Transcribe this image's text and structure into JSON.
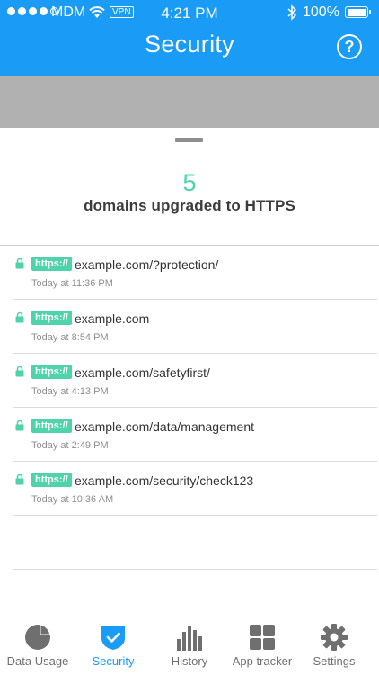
{
  "status_bar": {
    "carrier": "MDM",
    "vpn": "VPN",
    "time": "4:21 PM",
    "battery": "100%"
  },
  "header": {
    "title": "Security",
    "help": "?"
  },
  "summary": {
    "count": "5",
    "label": "domains upgraded to HTTPS"
  },
  "badge_text": "https://",
  "domains": [
    {
      "url": "example.com/?protection/",
      "time": "Today at 11:36 PM"
    },
    {
      "url": "example.com",
      "time": "Today at 8:54 PM"
    },
    {
      "url": "example.com/safetyfirst/",
      "time": "Today at 4:13 PM"
    },
    {
      "url": "example.com/data/management",
      "time": "Today at 2:49 PM"
    },
    {
      "url": "example.com/security/check123",
      "time": "Today at 10:36 AM"
    }
  ],
  "tabs": [
    {
      "label": "Data Usage",
      "icon": "pie-chart-icon",
      "active": false
    },
    {
      "label": "Security",
      "icon": "shield-check-icon",
      "active": true
    },
    {
      "label": "History",
      "icon": "bar-chart-icon",
      "active": false
    },
    {
      "label": "App tracker",
      "icon": "grid-icon",
      "active": false
    },
    {
      "label": "Settings",
      "icon": "gear-icon",
      "active": false
    }
  ],
  "colors": {
    "brand_blue": "#1a9bf5",
    "accent_green": "#4fd3ab",
    "inactive_gray": "#6f6f6f",
    "band_gray": "#b1b1b1"
  }
}
